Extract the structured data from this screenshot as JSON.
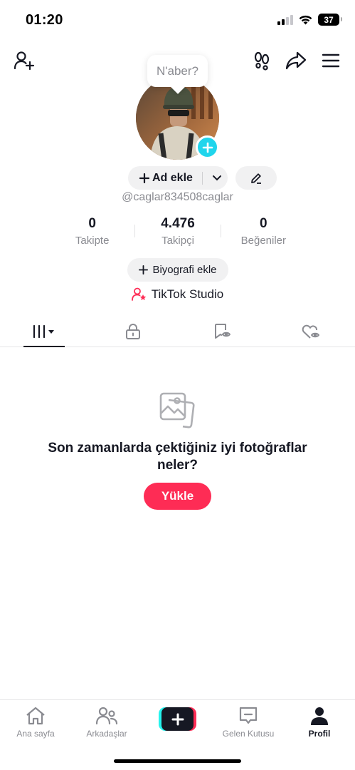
{
  "status_bar": {
    "time": "01:20",
    "battery": "37",
    "battery_level": 0.37
  },
  "bubble": {
    "text": "N'aber?"
  },
  "profile": {
    "add_name_label": "Ad ekle",
    "username": "@caglar834508caglar",
    "stats": [
      {
        "value": "0",
        "label": "Takipte"
      },
      {
        "value": "4.476",
        "label": "Takipçi"
      },
      {
        "value": "0",
        "label": "Beğeniler"
      }
    ],
    "bio_label": "Biyografi ekle",
    "studio_label": "TikTok Studio"
  },
  "empty_state": {
    "title": "Son zamanlarda çektiğiniz iyi fotoğraflar neler?",
    "button": "Yükle"
  },
  "bottom_nav": [
    {
      "label": "Ana sayfa"
    },
    {
      "label": "Arkadaşlar"
    },
    {
      "label": "Gelen Kutusu"
    },
    {
      "label": "Profil"
    }
  ],
  "colors": {
    "accent": "#fe2c55",
    "cyan": "#25f4ee",
    "text": "#161823",
    "muted": "#8a8b91"
  }
}
